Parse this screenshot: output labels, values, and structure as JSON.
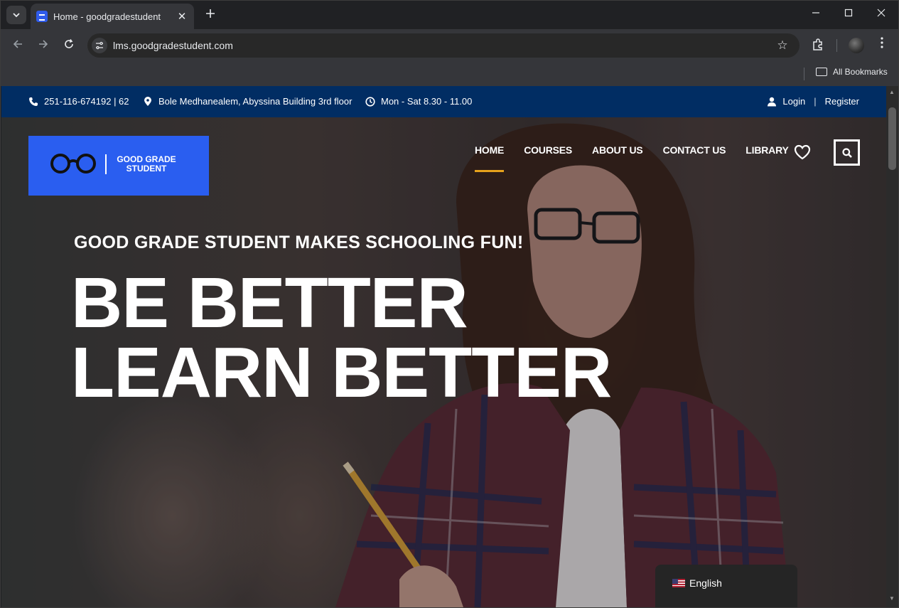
{
  "browser": {
    "tab_title": "Home - goodgradestudent",
    "url": "lms.goodgradestudent.com",
    "bookmarks_label": "All Bookmarks"
  },
  "icons": {
    "tab_menu": "chevron-down-icon",
    "new_tab": "plus-icon",
    "minimize": "minimize-icon",
    "maximize": "maximize-icon",
    "close": "close-icon",
    "back": "arrow-left-icon",
    "forward": "arrow-right-icon",
    "reload": "reload-icon",
    "site_info": "tune-icon",
    "bookmark": "star-icon",
    "extensions": "puzzle-icon",
    "menu": "more-vertical-icon",
    "phone": "phone-icon",
    "location": "map-pin-icon",
    "clock": "clock-icon",
    "user": "user-icon",
    "wishlist": "heart-icon",
    "search": "search-icon",
    "flag": "us-flag-icon"
  },
  "topbar": {
    "phone": "251-116-674192 | 62",
    "address": "Bole Medhanealem, Abyssina Building 3rd floor",
    "hours": "Mon - Sat 8.30 - 11.00",
    "login": "Login",
    "separator": "|",
    "register": "Register"
  },
  "logo": {
    "line1": "GOOD GRADE",
    "line2": "STUDENT"
  },
  "nav": {
    "items": [
      {
        "label": "HOME",
        "active": true
      },
      {
        "label": "COURSES"
      },
      {
        "label": "ABOUT US"
      },
      {
        "label": "CONTACT US"
      },
      {
        "label": "LIBRARY"
      }
    ]
  },
  "hero": {
    "tagline": "GOOD GRADE STUDENT MAKES SCHOOLING FUN!",
    "headline_line1": "BE BETTER",
    "headline_line2": "LEARN BETTER"
  },
  "language": {
    "current": "English"
  },
  "colors": {
    "topbar_bg": "#012d63",
    "logo_bg": "#2a5ef0",
    "nav_active_underline": "#e6a21c"
  }
}
